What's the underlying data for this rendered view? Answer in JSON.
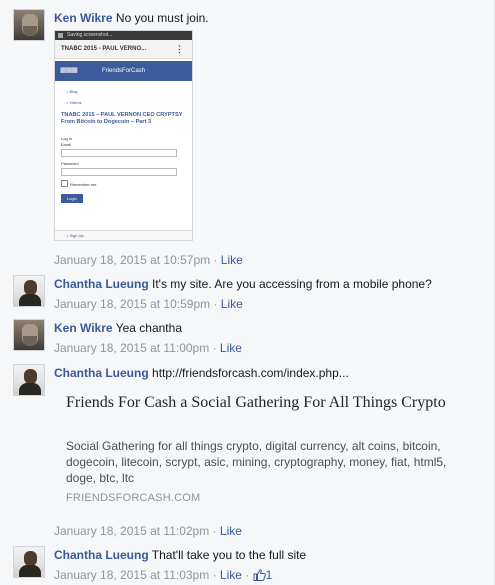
{
  "comments": [
    {
      "author": "Ken Wikre",
      "text": "No you must join.",
      "date": "January 18, 2015 at 10:57pm",
      "sep": " · ",
      "like_label": "Like",
      "screenshot": {
        "status_text": "Saving screenshot...",
        "url_title": "TNABC 2015 - PAUL VERNO...",
        "banner": "FriendsForCash",
        "crumb_1": "• Blog",
        "crumb_2": "• Videos",
        "title": "TNABC 2015 – PAUL VERNON CEO CRYPTSY From Bitcoin to Dogecoin – Part 3",
        "login_heading": "Log In",
        "email_label": "Email",
        "password_label": "Password",
        "remember_label": "Remember me",
        "login_button": "Login",
        "signup_label": "• Sign Up"
      }
    },
    {
      "author": "Chantha Lueung",
      "text": "It's my site. Are you accessing from a mobile phone?",
      "date": "January 18, 2015 at 10:59pm",
      "sep": " · ",
      "like_label": "Like"
    },
    {
      "author": "Ken Wikre",
      "text": "Yea chantha",
      "date": "January 18, 2015 at 11:00pm",
      "sep": " · ",
      "like_label": "Like"
    },
    {
      "author": "Chantha Lueung",
      "text": "http://friendsforcash.com/index.php...",
      "date": "January 18, 2015 at 11:02pm",
      "sep": " · ",
      "like_label": "Like",
      "link_preview": {
        "title": "Friends For Cash a Social Gathering For All Things Crypto",
        "description": "Social Gathering for all things crypto, digital currency, alt coins, bitcoin, dogecoin, litecoin, scrypt, asic, mining, cryptography, money, fiat, html5, doge, btc, ltc",
        "domain": "FRIENDSFORCASH.COM"
      }
    },
    {
      "author": "Chantha Lueung",
      "text": "That'll take you to the full site",
      "date": "January 18, 2015 at 11:03pm",
      "sep": " · ",
      "like_label": "Like",
      "like_count": "1",
      "like_icon": "thumbs-up-icon"
    }
  ],
  "colors": {
    "author_link": "#3b5998",
    "meta_text": "#90949c",
    "background": "#f6f7f9"
  }
}
